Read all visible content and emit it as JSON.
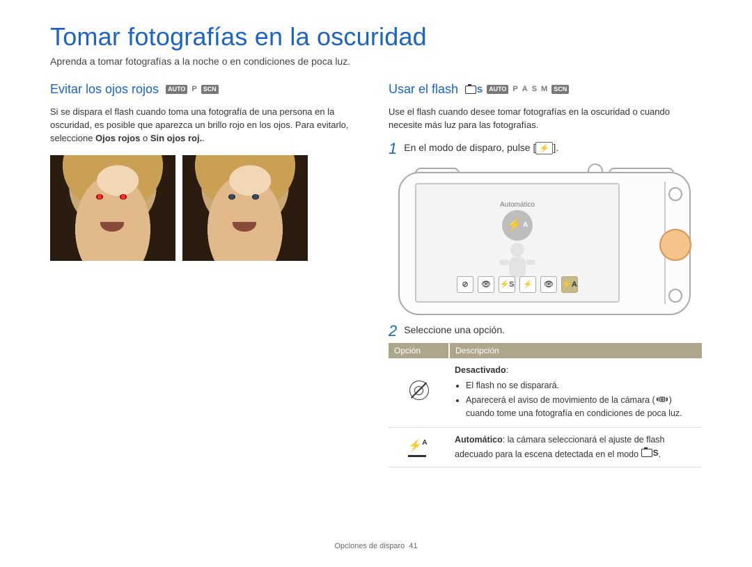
{
  "title": "Tomar fotografías en la oscuridad",
  "intro": "Aprenda a tomar fotografías a la noche o en condiciones de poca luz.",
  "left": {
    "heading": "Evitar los ojos rojos",
    "modes": {
      "auto": "AUTO",
      "p": "P",
      "scn": "SCN"
    },
    "body_pre": "Si se dispara el flash cuando toma una fotografía de una persona en la oscuridad, es posible que aparezca un brillo rojo en los ojos. Para evitarlo, seleccione ",
    "body_b1": "Ojos rojos",
    "body_mid": " o ",
    "body_b2": "Sin ojos roj.",
    "body_post": "."
  },
  "right": {
    "heading": "Usar el flash",
    "modes": {
      "cs": "S",
      "auto": "AUTO",
      "p": "P",
      "a": "A",
      "s": "S",
      "m": "M",
      "scn": "SCN"
    },
    "body": "Use el flash cuando desee tomar fotografías en la oscuridad o cuando necesite más luz para las fotografías.",
    "step1": {
      "num": "1",
      "pre": "En el modo de disparo, pulse [",
      "btn": "⚡",
      "post": "]."
    },
    "camera_screen": {
      "badge_label": "Automático",
      "badge_glyph": "⚡",
      "badge_sup": "A",
      "row": [
        "⊘",
        "👁",
        "⚡S",
        "⚡",
        "👁",
        "⚡A"
      ],
      "selected_index": 5
    },
    "step2": {
      "num": "2",
      "text": "Seleccione una opción."
    },
    "table": {
      "h1": "Opción",
      "h2": "Descripción",
      "rows": {
        "off": {
          "title": "Desactivado",
          "b1": "El flash no se disparará.",
          "b2_pre": "Aparecerá el aviso de movimiento de la cámara (",
          "b2_post": ") cuando tome una fotografía en condiciones de poca luz."
        },
        "auto": {
          "title": "Automático",
          "text_pre": ": la cámara seleccionará el ajuste de flash adecuado para la escena detectada en el modo ",
          "text_post": "."
        }
      }
    }
  },
  "footer": {
    "label": "Opciones de disparo",
    "page": "41"
  }
}
